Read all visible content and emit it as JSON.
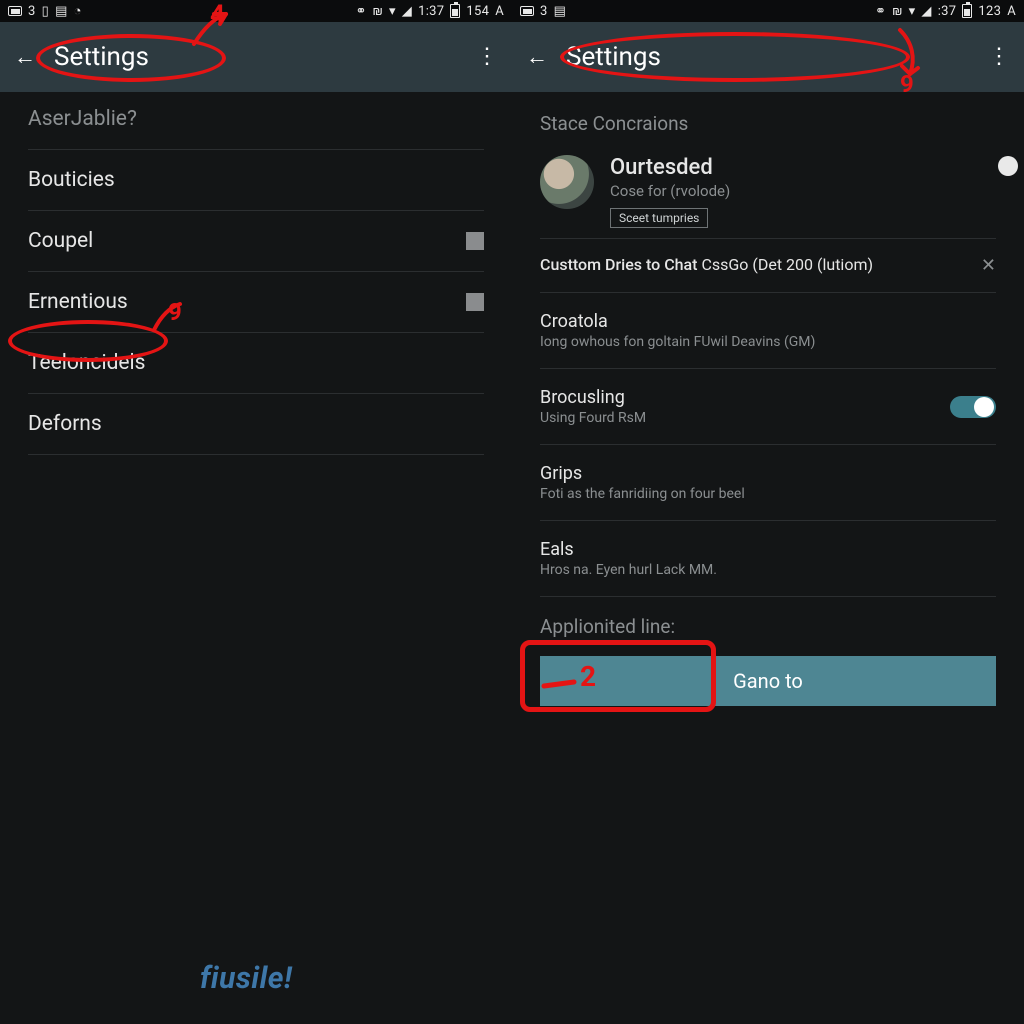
{
  "left": {
    "status": {
      "leftText": "3",
      "time": "1:37",
      "batt": "154",
      "ampm": "A"
    },
    "header": {
      "title": "Settings"
    },
    "rows": [
      {
        "label": "AserJablie?",
        "dim": true
      },
      {
        "label": "Bouticies"
      },
      {
        "label": "Coupel",
        "box": true
      },
      {
        "label": "Ernentious",
        "box": true
      },
      {
        "label": "Teeloncidels"
      },
      {
        "label": "Deforns"
      }
    ],
    "watermark": "fiusile!"
  },
  "right": {
    "status": {
      "leftText": "3",
      "time": ":37",
      "batt": "123",
      "ampm": "A"
    },
    "header": {
      "title": "Settings"
    },
    "section1": "Stace Concraions",
    "profile": {
      "name": "Ourtesded",
      "sub": "Cose for (rvolode)",
      "chip": "Sceet tumpries"
    },
    "custom": {
      "title": "Custtom Dries to Chat",
      "sub": "CssGo (Det 200 (lutiom)"
    },
    "rows": [
      {
        "title": "Croatola",
        "sub": "Iong owhous fon goltain FUwil Deavins (GM)"
      },
      {
        "title": "Brocusling",
        "sub": "Using Fourd RsM",
        "toggleOn": true
      },
      {
        "title": "Grips",
        "sub": "Foti as the fanridiing on four beel"
      },
      {
        "title": "Eals",
        "sub": "Hros na. Eyen hurl Lack MM."
      }
    ],
    "section2": "Applionited line:",
    "button": "Gano to"
  },
  "annotations": {
    "leftTitleNum": "4",
    "leftItemNum": "9",
    "rightTitleNum": "9",
    "buttonNum": "2"
  }
}
